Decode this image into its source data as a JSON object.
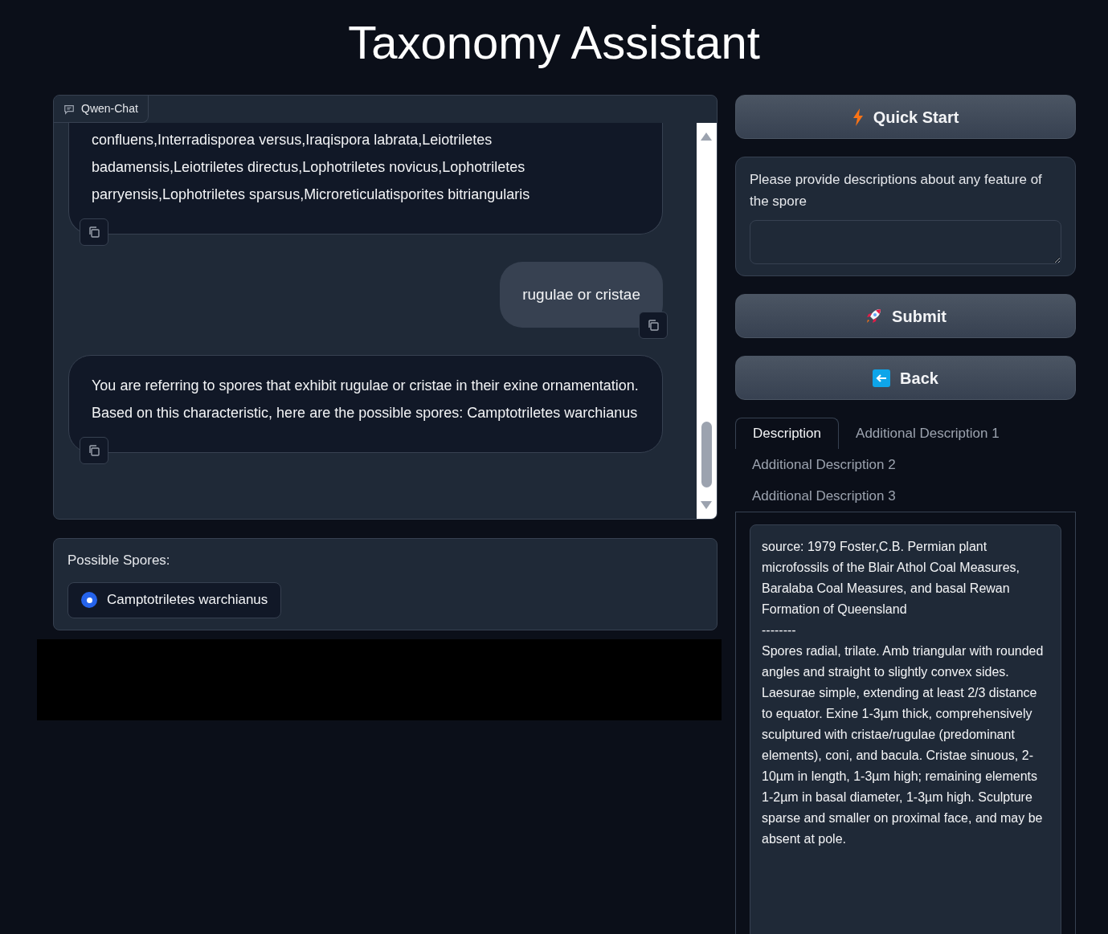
{
  "title": "Taxonomy Assistant",
  "chat": {
    "label": "Qwen-Chat",
    "messages": [
      {
        "kind": "bot",
        "text": "confluens,Interradisporea versus,Iraqispora labrata,Leiotriletes badamensis,Leiotriletes directus,Lophotriletes novicus,Lophotriletes parryensis,Lophotriletes sparsus,Microreticulatisporites bitriangularis"
      },
      {
        "kind": "user",
        "text": "rugulae or cristae"
      },
      {
        "kind": "bot",
        "text": "You are referring to spores that exhibit rugulae or cristae in their exine ornamentation. Based on this characteristic, here are the possible spores: Camptotriletes warchianus"
      }
    ]
  },
  "possible_spores": {
    "label": "Possible Spores:",
    "options": [
      {
        "label": "Camptotriletes warchianus",
        "selected": true
      }
    ]
  },
  "quick_start": {
    "label": "Quick Start"
  },
  "feature_input": {
    "label": "Please provide descriptions about any feature of the spore"
  },
  "submit": {
    "label": "Submit"
  },
  "back": {
    "label": "Back"
  },
  "tabs": [
    {
      "label": "Description",
      "selected": true
    },
    {
      "label": "Additional Description 1",
      "selected": false
    },
    {
      "label": "Additional Description 2",
      "selected": false
    },
    {
      "label": "Additional Description 3",
      "selected": false
    }
  ],
  "description": {
    "source": "source: 1979 Foster,C.B. Permian plant microfossils of the Blair Athol Coal Measures, Baralaba Coal Measures, and basal Rewan Formation of Queensland",
    "separator": "--------",
    "body": "Spores radial, trilate. Amb triangular with rounded angles and straight to slightly convex sides. Laesurae simple, extending at least 2/3 distance to equator. Exine 1-3µm thick, comprehensively sculptured with cristae/rugulae (predominant elements), coni, and bacula. Cristae sinuous, 2-10µm in length, 1-3µm high; remaining elements 1-2µm in basal diameter, 1-3µm high. Sculpture sparse and smaller on proximal face, and may be absent at pole."
  }
}
